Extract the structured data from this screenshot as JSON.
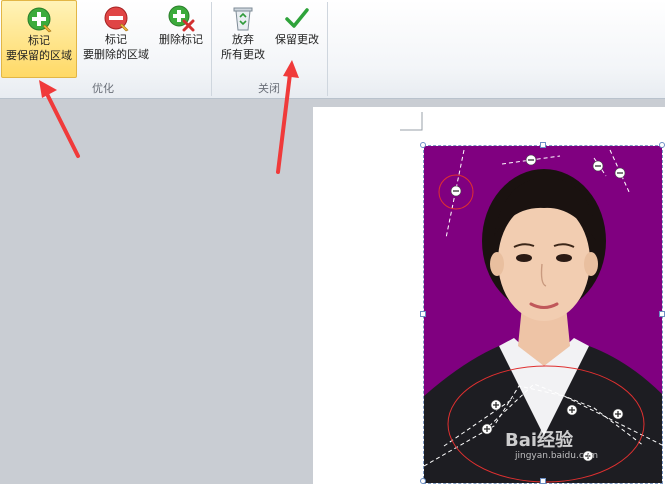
{
  "ribbon": {
    "groups": [
      {
        "label": "优化"
      },
      {
        "label": "关闭"
      }
    ],
    "buttons": [
      {
        "line1": "标记",
        "line2": "要保留的区域",
        "icon": "plus-pencil-icon"
      },
      {
        "line1": "标记",
        "line2": "要删除的区域",
        "icon": "minus-pencil-icon"
      },
      {
        "line1": "删除标记",
        "icon": "delete-mark-icon"
      },
      {
        "line1": "放弃",
        "line2": "所有更改",
        "icon": "recycle-bin-icon"
      },
      {
        "line1": "保留更改",
        "icon": "checkmark-icon"
      }
    ]
  },
  "watermark": {
    "text": "Bai经验",
    "sub": "jingyan.baidu.com"
  },
  "colors": {
    "photo_background": "#800080",
    "active_button": "#ffd966",
    "annotation_arrow": "#f03a3a",
    "keep_marker": "#ffffff",
    "circle_highlight": "#e03030"
  }
}
